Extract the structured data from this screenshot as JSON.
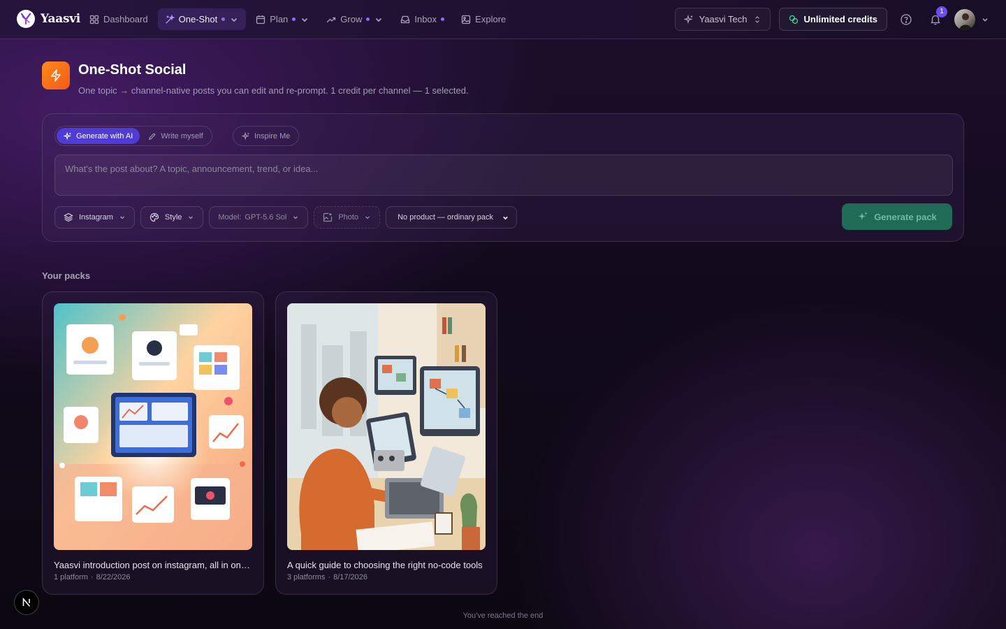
{
  "brand": {
    "name": "Yaasvi"
  },
  "nav": {
    "items": [
      {
        "label": "Dashboard",
        "icon": "grid-icon",
        "dot": false,
        "chevron": false,
        "active": false
      },
      {
        "label": "One-Shot",
        "icon": "magic-wand-icon",
        "dot": true,
        "chevron": true,
        "active": true
      },
      {
        "label": "Plan",
        "icon": "calendar-icon",
        "dot": true,
        "chevron": true,
        "active": false
      },
      {
        "label": "Grow",
        "icon": "trending-up-icon",
        "dot": true,
        "chevron": true,
        "active": false
      },
      {
        "label": "Inbox",
        "icon": "inbox-icon",
        "dot": true,
        "chevron": false,
        "active": false
      },
      {
        "label": "Explore",
        "icon": "image-gallery-icon",
        "dot": false,
        "chevron": false,
        "active": false
      }
    ],
    "workspace": "Yaasvi Tech",
    "credits": "Unlimited credits",
    "notifications_count": "1"
  },
  "header": {
    "title": "One-Shot Social",
    "subtitle": "One topic → channel-native posts you can edit and re-prompt. 1 credit per channel — 1 selected."
  },
  "composer": {
    "modes": [
      {
        "label": "Generate with AI",
        "active": true
      },
      {
        "label": "Write myself",
        "active": false
      }
    ],
    "inspire_label": "Inspire Me",
    "topic_placeholder": "What's the post about? A topic, announcement, trend, or idea...",
    "platform": "Instagram",
    "style": "Style",
    "model_prefix": "Model:",
    "model_value": "GPT-5.6 Sol",
    "media": "Photo",
    "product_select": "No product — ordinary pack",
    "generate_label": "Generate pack"
  },
  "packs": {
    "section_label": "Your packs",
    "items": [
      {
        "title": "Yaasvi introduction post on instagram, all in one place",
        "platforms": "1 platform",
        "date": "8/22/2026"
      },
      {
        "title": "A quick guide to choosing the right no-code tools",
        "platforms": "3 platforms",
        "date": "8/17/2026"
      }
    ],
    "end_text": "You've reached the end"
  },
  "colors": {
    "accent": "#4f3bd6",
    "brand_orange": "#f46a16",
    "generate_button": "#1f6b56",
    "nav_dot": "#8b6cff"
  }
}
